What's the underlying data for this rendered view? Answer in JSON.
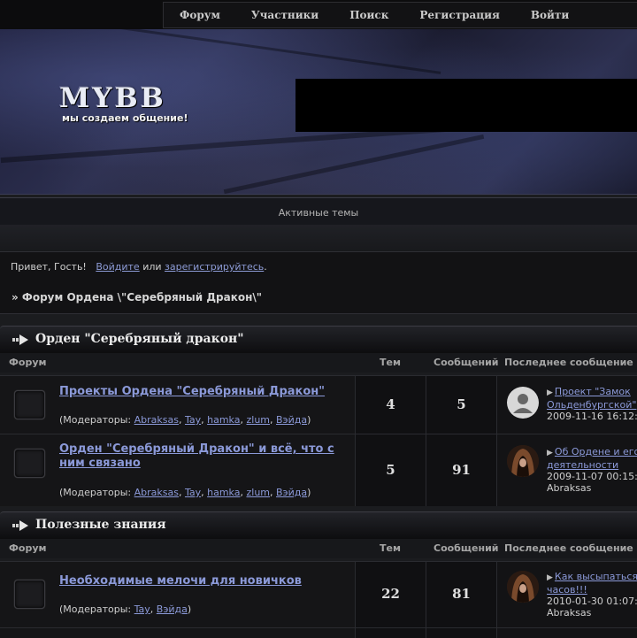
{
  "nav": {
    "items": [
      "Форум",
      "Участники",
      "Поиск",
      "Регистрация",
      "Войти"
    ]
  },
  "logo": {
    "main": "MYBB",
    "sub": "мы создаем общение!"
  },
  "active_topics": "Активные темы",
  "guest": {
    "greeting": "Привет, Гость!",
    "login": "Войдите",
    "or": "или",
    "register": "зарегистрируйтесь",
    "dot": "."
  },
  "breadcrumb": "» Форум Ордена \\\"Серебряный Дракон\\\"",
  "columns": {
    "forum": "Форум",
    "topics": "Тем",
    "posts": "Сообщений",
    "last": "Последнее сообщение"
  },
  "categories": [
    {
      "title": "Орден \"Серебряный дракон\"",
      "forums": [
        {
          "title": "Проекты Ордена \"Серебряный Дракон\"",
          "mods_label": "(Модераторы: ",
          "mods": [
            "Abraksas",
            "Tay",
            "hamka",
            "zlum",
            "Вэйда"
          ],
          "mods_end": ")",
          "topics": "4",
          "posts": "5",
          "last_link_1": "Проект \"Замок",
          "last_link_2": "Ольденбургской\"",
          "last_date": "2009-11-16 16:12:",
          "last_author": ""
        },
        {
          "title_1": "Орден \"Серебряный Дракон\" и всё, что с",
          "title_2": "ним связано",
          "mods_label": "(Модераторы: ",
          "mods": [
            "Abraksas",
            "Tay",
            "hamka",
            "zlum",
            "Вэйда"
          ],
          "mods_end": ")",
          "topics": "5",
          "posts": "91",
          "last_link_1": "Об Ордене и его",
          "last_link_2": "деятельности",
          "last_date": "2009-11-07 00:15:",
          "last_author": "Abraksas"
        }
      ]
    },
    {
      "title": "Полезные знания",
      "forums": [
        {
          "title": "Необходимые мелочи для новичков",
          "mods_label": "(Модераторы: ",
          "mods": [
            "Tay",
            "Вэйда"
          ],
          "mods_end": ")",
          "topics": "22",
          "posts": "81",
          "last_link_1": "Как высыпаться",
          "last_link_2": "часов!!!",
          "last_date": "2010-01-30 01:07:",
          "last_author": "Abraksas"
        }
      ]
    }
  ],
  "colors": {
    "link": "#8b99d8",
    "background": "#1b1c1f",
    "header_bg": "#0c0c0d"
  }
}
